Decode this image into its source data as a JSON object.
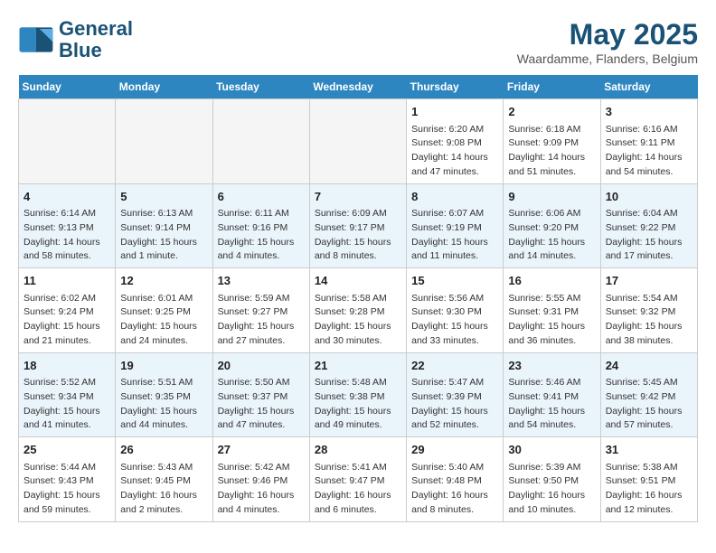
{
  "header": {
    "logo_line1": "General",
    "logo_line2": "Blue",
    "month": "May 2025",
    "location": "Waardamme, Flanders, Belgium"
  },
  "days_of_week": [
    "Sunday",
    "Monday",
    "Tuesday",
    "Wednesday",
    "Thursday",
    "Friday",
    "Saturday"
  ],
  "weeks": [
    [
      {
        "day": "",
        "info": ""
      },
      {
        "day": "",
        "info": ""
      },
      {
        "day": "",
        "info": ""
      },
      {
        "day": "",
        "info": ""
      },
      {
        "day": "1",
        "info": "Sunrise: 6:20 AM\nSunset: 9:08 PM\nDaylight: 14 hours\nand 47 minutes."
      },
      {
        "day": "2",
        "info": "Sunrise: 6:18 AM\nSunset: 9:09 PM\nDaylight: 14 hours\nand 51 minutes."
      },
      {
        "day": "3",
        "info": "Sunrise: 6:16 AM\nSunset: 9:11 PM\nDaylight: 14 hours\nand 54 minutes."
      }
    ],
    [
      {
        "day": "4",
        "info": "Sunrise: 6:14 AM\nSunset: 9:13 PM\nDaylight: 14 hours\nand 58 minutes."
      },
      {
        "day": "5",
        "info": "Sunrise: 6:13 AM\nSunset: 9:14 PM\nDaylight: 15 hours\nand 1 minute."
      },
      {
        "day": "6",
        "info": "Sunrise: 6:11 AM\nSunset: 9:16 PM\nDaylight: 15 hours\nand 4 minutes."
      },
      {
        "day": "7",
        "info": "Sunrise: 6:09 AM\nSunset: 9:17 PM\nDaylight: 15 hours\nand 8 minutes."
      },
      {
        "day": "8",
        "info": "Sunrise: 6:07 AM\nSunset: 9:19 PM\nDaylight: 15 hours\nand 11 minutes."
      },
      {
        "day": "9",
        "info": "Sunrise: 6:06 AM\nSunset: 9:20 PM\nDaylight: 15 hours\nand 14 minutes."
      },
      {
        "day": "10",
        "info": "Sunrise: 6:04 AM\nSunset: 9:22 PM\nDaylight: 15 hours\nand 17 minutes."
      }
    ],
    [
      {
        "day": "11",
        "info": "Sunrise: 6:02 AM\nSunset: 9:24 PM\nDaylight: 15 hours\nand 21 minutes."
      },
      {
        "day": "12",
        "info": "Sunrise: 6:01 AM\nSunset: 9:25 PM\nDaylight: 15 hours\nand 24 minutes."
      },
      {
        "day": "13",
        "info": "Sunrise: 5:59 AM\nSunset: 9:27 PM\nDaylight: 15 hours\nand 27 minutes."
      },
      {
        "day": "14",
        "info": "Sunrise: 5:58 AM\nSunset: 9:28 PM\nDaylight: 15 hours\nand 30 minutes."
      },
      {
        "day": "15",
        "info": "Sunrise: 5:56 AM\nSunset: 9:30 PM\nDaylight: 15 hours\nand 33 minutes."
      },
      {
        "day": "16",
        "info": "Sunrise: 5:55 AM\nSunset: 9:31 PM\nDaylight: 15 hours\nand 36 minutes."
      },
      {
        "day": "17",
        "info": "Sunrise: 5:54 AM\nSunset: 9:32 PM\nDaylight: 15 hours\nand 38 minutes."
      }
    ],
    [
      {
        "day": "18",
        "info": "Sunrise: 5:52 AM\nSunset: 9:34 PM\nDaylight: 15 hours\nand 41 minutes."
      },
      {
        "day": "19",
        "info": "Sunrise: 5:51 AM\nSunset: 9:35 PM\nDaylight: 15 hours\nand 44 minutes."
      },
      {
        "day": "20",
        "info": "Sunrise: 5:50 AM\nSunset: 9:37 PM\nDaylight: 15 hours\nand 47 minutes."
      },
      {
        "day": "21",
        "info": "Sunrise: 5:48 AM\nSunset: 9:38 PM\nDaylight: 15 hours\nand 49 minutes."
      },
      {
        "day": "22",
        "info": "Sunrise: 5:47 AM\nSunset: 9:39 PM\nDaylight: 15 hours\nand 52 minutes."
      },
      {
        "day": "23",
        "info": "Sunrise: 5:46 AM\nSunset: 9:41 PM\nDaylight: 15 hours\nand 54 minutes."
      },
      {
        "day": "24",
        "info": "Sunrise: 5:45 AM\nSunset: 9:42 PM\nDaylight: 15 hours\nand 57 minutes."
      }
    ],
    [
      {
        "day": "25",
        "info": "Sunrise: 5:44 AM\nSunset: 9:43 PM\nDaylight: 15 hours\nand 59 minutes."
      },
      {
        "day": "26",
        "info": "Sunrise: 5:43 AM\nSunset: 9:45 PM\nDaylight: 16 hours\nand 2 minutes."
      },
      {
        "day": "27",
        "info": "Sunrise: 5:42 AM\nSunset: 9:46 PM\nDaylight: 16 hours\nand 4 minutes."
      },
      {
        "day": "28",
        "info": "Sunrise: 5:41 AM\nSunset: 9:47 PM\nDaylight: 16 hours\nand 6 minutes."
      },
      {
        "day": "29",
        "info": "Sunrise: 5:40 AM\nSunset: 9:48 PM\nDaylight: 16 hours\nand 8 minutes."
      },
      {
        "day": "30",
        "info": "Sunrise: 5:39 AM\nSunset: 9:50 PM\nDaylight: 16 hours\nand 10 minutes."
      },
      {
        "day": "31",
        "info": "Sunrise: 5:38 AM\nSunset: 9:51 PM\nDaylight: 16 hours\nand 12 minutes."
      }
    ]
  ]
}
